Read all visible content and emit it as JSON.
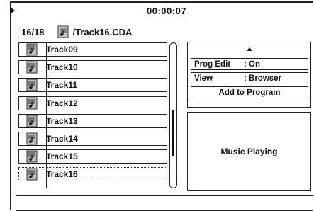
{
  "header": {
    "play_icon": "play-icon",
    "time": "00:00:07",
    "track_count": "16/18",
    "current_path": "/Track16.CDA",
    "file_icon": "music-file-icon"
  },
  "tracks": [
    {
      "label": "Track09",
      "icon": "music-file-icon"
    },
    {
      "label": "Track10",
      "icon": "music-file-icon"
    },
    {
      "label": "Track11",
      "icon": "music-file-icon"
    },
    {
      "label": "Track12",
      "icon": "music-file-icon"
    },
    {
      "label": "Track13",
      "icon": "music-file-icon"
    },
    {
      "label": "Track14",
      "icon": "music-file-icon"
    },
    {
      "label": "Track15",
      "icon": "music-file-icon"
    },
    {
      "label": "Track16",
      "icon": "music-file-icon",
      "selected": true
    }
  ],
  "menu": {
    "up_icon": "up-arrow-icon",
    "prog_edit_label": "Prog Edit",
    "prog_edit_value": ": On",
    "view_label": "View",
    "view_value": ": Browser",
    "add_to_program": "Add to Program"
  },
  "status": {
    "text": "Music Playing"
  },
  "info_bar": {
    "text": ""
  }
}
